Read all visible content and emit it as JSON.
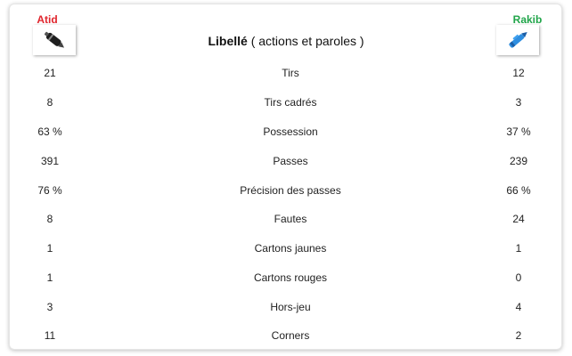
{
  "teams": {
    "home": {
      "name": "Atid",
      "icon": "fountain-pen-icon",
      "color": "#e0242c"
    },
    "away": {
      "name": "Rakib",
      "icon": "blue-pen-icon",
      "color": "#21a54a"
    }
  },
  "header": {
    "title_bold": "Libellé",
    "title_rest": "( actions et paroles )"
  },
  "stats": [
    {
      "home": "21",
      "label": "Tirs",
      "away": "12"
    },
    {
      "home": "8",
      "label": "Tirs cadrés",
      "away": "3"
    },
    {
      "home": "63 %",
      "label": "Possession",
      "away": "37 %"
    },
    {
      "home": "391",
      "label": "Passes",
      "away": "239"
    },
    {
      "home": "76 %",
      "label": "Précision des passes",
      "away": "66 %"
    },
    {
      "home": "8",
      "label": "Fautes",
      "away": "24"
    },
    {
      "home": "1",
      "label": "Cartons jaunes",
      "away": "1"
    },
    {
      "home": "1",
      "label": "Cartons rouges",
      "away": "0"
    },
    {
      "home": "3",
      "label": "Hors-jeu",
      "away": "4"
    },
    {
      "home": "11",
      "label": "Corners",
      "away": "2"
    }
  ]
}
